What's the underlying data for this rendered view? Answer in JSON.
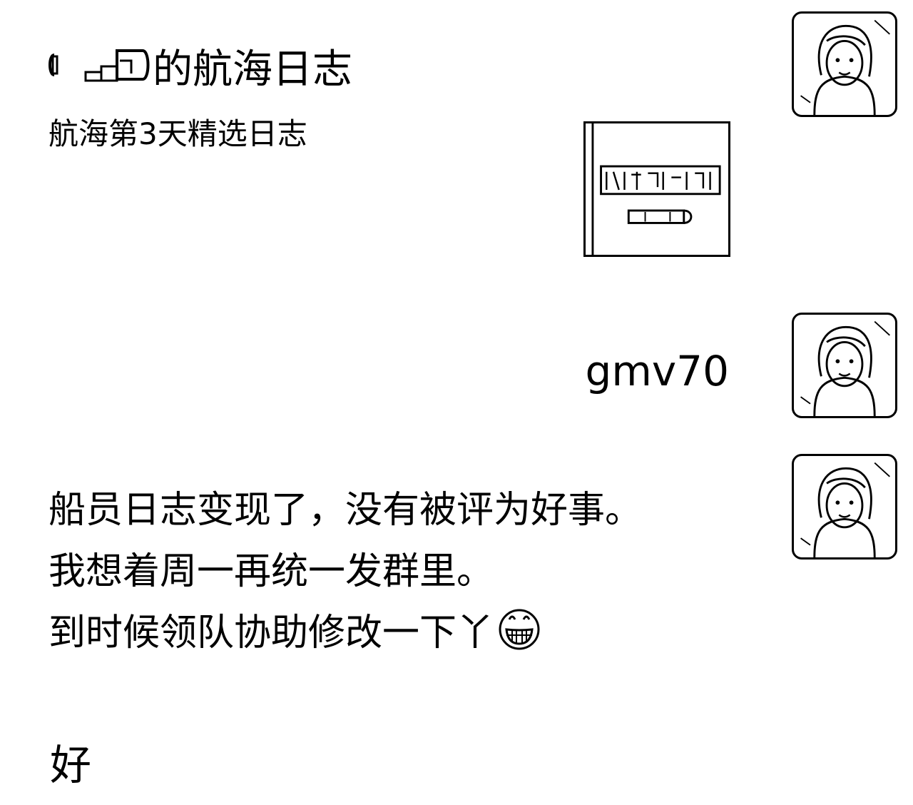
{
  "card": {
    "title_suffix": "的航海日志",
    "subtitle": "航海第3天精选日志"
  },
  "sender": {
    "name": "gmv70"
  },
  "message": {
    "lines": [
      "船员日志变现了，没有被评为好事。",
      "我想着周一再统一发群里。",
      "到时候领队协助修改一下丫"
    ],
    "emoji": "grinning-face-icon"
  },
  "reply": {
    "text": "好"
  },
  "colors": {
    "ink": "#000000",
    "background": "#ffffff"
  }
}
